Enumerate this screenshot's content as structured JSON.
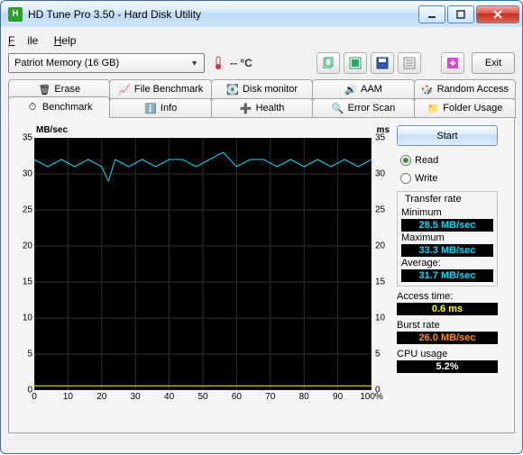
{
  "window": {
    "title": "HD Tune Pro 3.50 - Hard Disk Utility",
    "icon_label": "H"
  },
  "menu": {
    "file": "File",
    "help": "Help"
  },
  "toolbar": {
    "drive": "Patriot Memory (16 GB)",
    "temp": "-- °C",
    "exit": "Exit"
  },
  "tabs_row1": [
    {
      "id": "erase",
      "label": "Erase"
    },
    {
      "id": "filebench",
      "label": "File Benchmark"
    },
    {
      "id": "diskmon",
      "label": "Disk monitor"
    },
    {
      "id": "aam",
      "label": "AAM"
    },
    {
      "id": "random",
      "label": "Random Access"
    }
  ],
  "tabs_row2": [
    {
      "id": "bench",
      "label": "Benchmark",
      "active": true
    },
    {
      "id": "info",
      "label": "Info"
    },
    {
      "id": "health",
      "label": "Health"
    },
    {
      "id": "errorscan",
      "label": "Error Scan"
    },
    {
      "id": "folder",
      "label": "Folder Usage"
    }
  ],
  "chart_data": {
    "type": "line",
    "y_left_label": "MB/sec",
    "y_right_label": "ms",
    "x_label": "%",
    "y_left_max": 35,
    "y_right_max": 35,
    "y_left_ticks": [
      35,
      30,
      25,
      20,
      15,
      10,
      5,
      0
    ],
    "y_right_ticks": [
      35,
      30,
      25,
      20,
      15,
      10,
      5,
      0
    ],
    "x_ticks": [
      0,
      10,
      20,
      30,
      40,
      50,
      60,
      70,
      80,
      90,
      100
    ],
    "series": [
      {
        "name": "Transfer rate",
        "axis": "left",
        "color": "#00d9ff",
        "x": [
          0,
          4,
          8,
          12,
          16,
          20,
          22,
          24,
          28,
          32,
          36,
          40,
          44,
          48,
          52,
          56,
          60,
          64,
          68,
          72,
          76,
          80,
          84,
          88,
          92,
          96,
          100
        ],
        "y": [
          32,
          31,
          32,
          31,
          32,
          31,
          29,
          32,
          31,
          32,
          31,
          32,
          32,
          31,
          32,
          33,
          31,
          32,
          32,
          31,
          32,
          31,
          32,
          31,
          32,
          31,
          32
        ]
      },
      {
        "name": "Access time",
        "axis": "right",
        "color": "#ffff00",
        "x": [
          0,
          10,
          20,
          30,
          40,
          50,
          60,
          70,
          80,
          90,
          100
        ],
        "y": [
          0.6,
          0.6,
          0.6,
          0.6,
          0.6,
          0.6,
          0.6,
          0.6,
          0.6,
          0.6,
          0.6
        ]
      }
    ]
  },
  "side": {
    "start": "Start",
    "read": "Read",
    "write": "Write",
    "read_selected": true,
    "transfer_title": "Transfer rate",
    "min_label": "Minimum",
    "min_val": "28.5 MB/sec",
    "max_label": "Maximum",
    "max_val": "33.3 MB/sec",
    "avg_label": "Average:",
    "avg_val": "31.7 MB/sec",
    "access_label": "Access time:",
    "access_val": "0.6 ms",
    "burst_label": "Burst rate",
    "burst_val": "26.0 MB/sec",
    "cpu_label": "CPU usage",
    "cpu_val": "5.2%"
  }
}
